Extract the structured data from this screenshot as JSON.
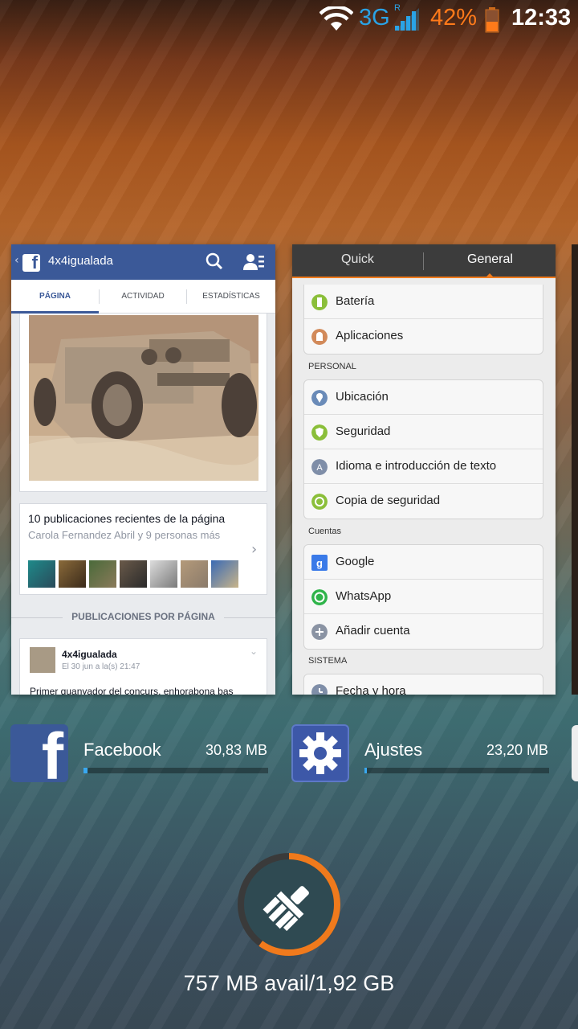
{
  "status_bar": {
    "network": "3G",
    "roaming": "R",
    "battery": "42%",
    "time": "12:33"
  },
  "cards": {
    "facebook": {
      "page_title": "4x4igualada",
      "tabs": [
        "PÁGINA",
        "ACTIVIDAD",
        "ESTADÍSTICAS"
      ],
      "recent_title": "10 publicaciones recientes de la página",
      "recent_sub": "Carola Fernandez Abril y 9 personas más",
      "section_header": "PUBLICACIONES POR PÁGINA",
      "post_author": "4x4igualada",
      "post_date": "El 30 jun a la(s) 21:47",
      "post_text": "Primer guanyador del concurs, enhorabona bas"
    },
    "settings": {
      "tabs": [
        "Quick",
        "General"
      ],
      "selected_tab": "General",
      "group1": [
        "Batería",
        "Aplicaciones"
      ],
      "personal_header": "PERSONAL",
      "personal": [
        "Ubicación",
        "Seguridad",
        "Idioma e introducción de texto",
        "Copia de seguridad"
      ],
      "accounts_header": "Cuentas",
      "accounts": [
        "Google",
        "WhatsApp",
        "Añadir cuenta"
      ],
      "system_header": "SISTEMA",
      "system": [
        "Fecha y hora"
      ]
    }
  },
  "apps": [
    {
      "name": "Facebook",
      "size": "30,83 MB",
      "usage_fraction": 0.02
    },
    {
      "name": "Ajustes",
      "size": "23,20 MB",
      "usage_fraction": 0.015
    }
  ],
  "memory": {
    "summary": "757 MB avail/1,92 GB",
    "used_fraction": 0.6
  },
  "colors": {
    "accent_orange": "#f07a1c",
    "network_blue": "#2aa3e6",
    "facebook_blue": "#3b5998"
  }
}
